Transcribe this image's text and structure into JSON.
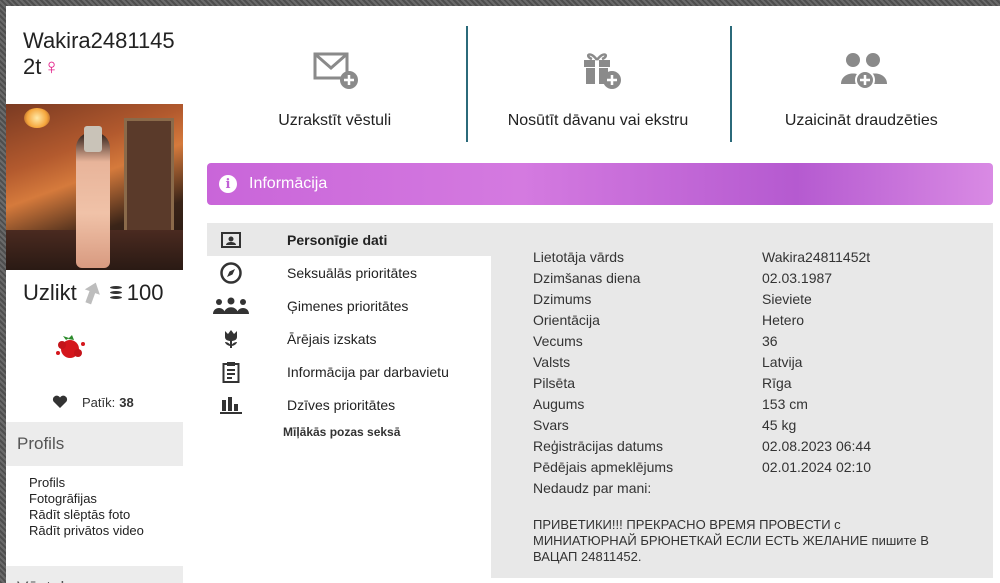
{
  "profile": {
    "username": "Wakira24811452t",
    "gender_symbol": "♀",
    "uzlikt_label": "Uzlikt",
    "coins": "100",
    "likes_label": "Patīk:",
    "likes_count": "38"
  },
  "left_sections": {
    "profils_title": "Profils",
    "links": [
      "Profils",
      "Fotogrāfijas",
      "Rādīt slēptās foto",
      "Rādīt privātos video"
    ],
    "vestules_title": "Vēstules"
  },
  "actions": [
    {
      "label": "Uzrakstīt vēstuli",
      "icon": "envelope-plus-icon"
    },
    {
      "label": "Nosūtīt dāvanu vai ekstru",
      "icon": "gift-plus-icon"
    },
    {
      "label": "Uzaicināt draudzēties",
      "icon": "add-friend-icon"
    }
  ],
  "info_banner": {
    "title": "Informācija"
  },
  "tabs": [
    {
      "label": "Personīgie dati",
      "icon": "id-card-icon",
      "active": true
    },
    {
      "label": "Seksuālās prioritātes",
      "icon": "compass-icon"
    },
    {
      "label": "Ģimenes prioritātes",
      "icon": "family-icon"
    },
    {
      "label": "Ārējais izskats",
      "icon": "tulip-icon"
    },
    {
      "label": "Informācija par darbavietu",
      "icon": "clipboard-icon"
    },
    {
      "label": "Dzīves prioritātes",
      "icon": "bar-chart-icon"
    }
  ],
  "subtab": "Mīļākās pozas seksā",
  "details": [
    {
      "key": "Lietotāja vārds",
      "value": "Wakira24811452t"
    },
    {
      "key": "Dzimšanas diena",
      "value": "02.03.1987"
    },
    {
      "key": "Dzimums",
      "value": "Sieviete"
    },
    {
      "key": "Orientācija",
      "value": "Hetero"
    },
    {
      "key": "Vecums",
      "value": "36"
    },
    {
      "key": "Valsts",
      "value": "Latvija"
    },
    {
      "key": "Pilsēta",
      "value": "Rīga"
    },
    {
      "key": "Augums",
      "value": "153 cm"
    },
    {
      "key": "Svars",
      "value": "45 kg"
    },
    {
      "key": "Reģistrācijas datums",
      "value": "02.08.2023 06:44"
    },
    {
      "key": "Pēdējais apmeklējums",
      "value": "02.01.2024 02:10"
    },
    {
      "key": "Nedaudz par mani:",
      "value": ""
    }
  ],
  "about_text": "ПРИВЕТИКИ!!! ПРЕКРАСНО ВРЕМЯ ПРОВЕСТИ с МИНИАТЮРНАЙ БРЮНЕТКАЙ ЕСЛИ ЕСТЬ ЖЕЛАНИЕ пишите В ВАЦАП 24811452.",
  "colors": {
    "accent": "#c965d9",
    "divider": "#2b6a7a",
    "gender": "#e3218a"
  }
}
